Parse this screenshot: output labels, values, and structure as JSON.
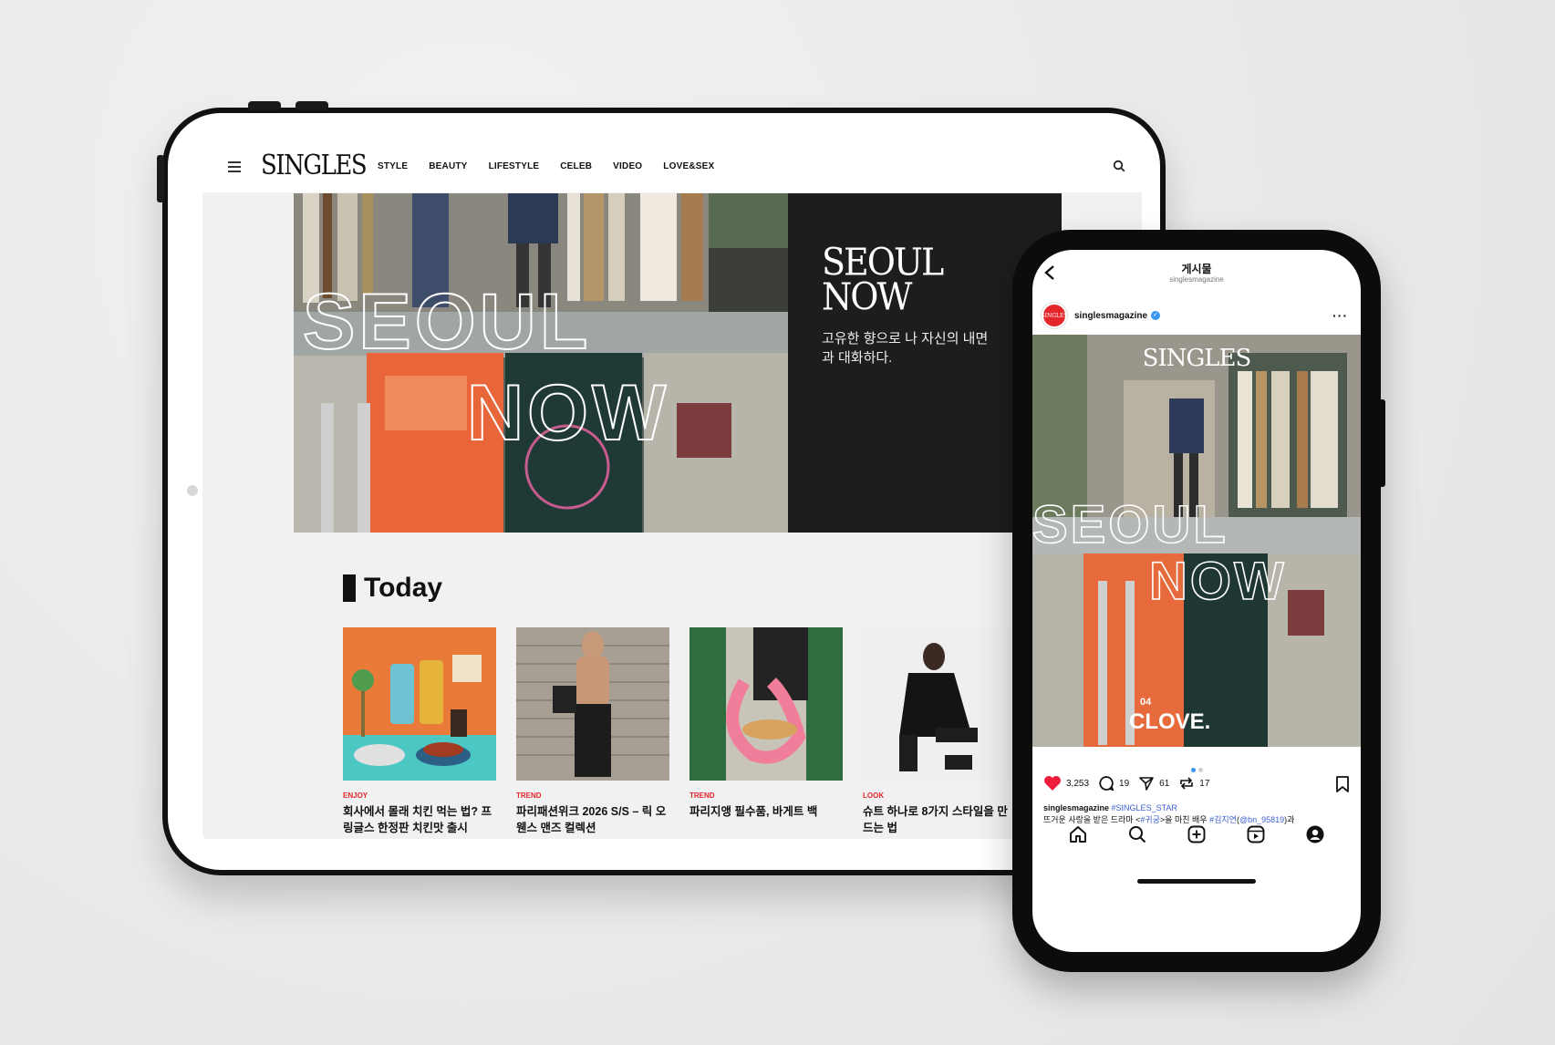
{
  "tablet": {
    "site": {
      "logo": "SINGLES",
      "menu": [
        "STYLE",
        "BEAUTY",
        "LIFESTYLE",
        "CELEB",
        "VIDEO",
        "LOVE&SEX"
      ]
    },
    "hero": {
      "overlay_text": [
        "SEOUL",
        "NOW"
      ],
      "title_line1": "SEOUL",
      "title_line2": "NOW",
      "subtitle": "고유한 향으로 나 자신의 내면과 대화하다."
    },
    "today": {
      "heading": "Today",
      "cards": [
        {
          "category": "ENJOY",
          "title": "회사에서 몰래 치킨 먹는 법? 프링글스 한정판 치킨맛 출시"
        },
        {
          "category": "TREND",
          "title": "파리패션위크 2026 S/S – 릭 오웬스 맨즈 컬렉션"
        },
        {
          "category": "TREND",
          "title": "파리지앵 필수품, 바게트 백"
        },
        {
          "category": "LOOK",
          "title": "슈트 하나로 8가지 스타일을 만드는 법"
        }
      ]
    }
  },
  "phone": {
    "header_title": "게시물",
    "header_handle": "singlesmagazine",
    "username": "singlesmagazine",
    "avatar_text": "SINGLES",
    "post": {
      "logo": "SINGLES",
      "overlay_text": [
        "SEOUL",
        "NOW"
      ],
      "number": "04",
      "name": "CLOVE."
    },
    "likes": "3,253",
    "comments": "19",
    "shares": "61",
    "reposts": "17",
    "caption_user": "singlesmagazine",
    "caption_tag": "#SINGLES_STAR",
    "caption_line_a": "뜨거운 사랑을 받은 드라마 <",
    "caption_link_a": "#귀궁",
    "caption_line_b": ">을 마친 배우 ",
    "caption_link_b": "#김지연",
    "caption_line_c": "(",
    "caption_link_c": "@bn_95819",
    "caption_line_d": ")과",
    "colors": {
      "accent": "#e4262a",
      "link": "#3d5fd0",
      "verified": "#3897f0"
    }
  }
}
